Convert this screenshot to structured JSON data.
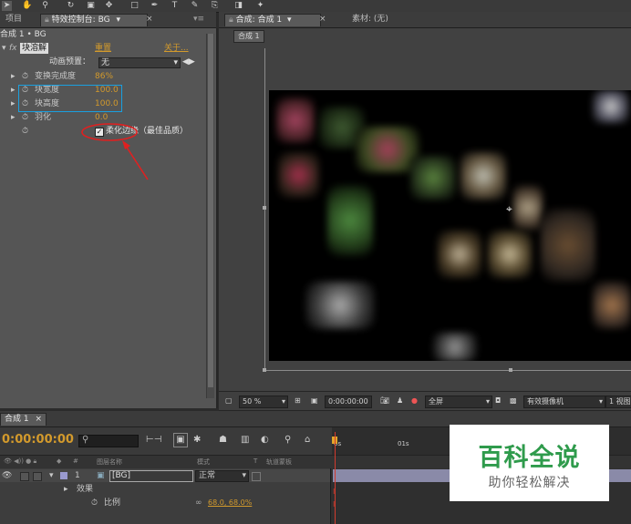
{
  "toolbar": {
    "icons": [
      "selection-tool-icon",
      "hand-tool-icon",
      "zoom-tool-icon",
      "rotate-tool-icon",
      "camera-tool-icon",
      "pan-behind-icon",
      "mask-tool-icon",
      "pen-tool-icon",
      "text-tool-icon",
      "brush-tool-icon",
      "clone-tool-icon",
      "eraser-tool-icon",
      "puppet-tool-icon"
    ]
  },
  "left_panel": {
    "tab_project": "项目",
    "tab_effects": "特效控制台: BG",
    "menu_glyph": "▾≡",
    "breadcrumb": "合成 1 • BG",
    "effect_name": "块溶解",
    "reset": "重置",
    "about": "关于...",
    "preset_label": "动画预置：",
    "preset_value": "无",
    "props": [
      {
        "label": "变换完成度",
        "value": "86%"
      },
      {
        "label": "块宽度",
        "value": "100.0"
      },
      {
        "label": "块高度",
        "value": "100.0"
      },
      {
        "label": "羽化",
        "value": "0.0"
      }
    ],
    "checkbox_label": "柔化边缘（最佳品质）",
    "checkbox_checked": true,
    "fx_badge": "fx"
  },
  "viewer": {
    "tab_comp": "合成: 合成 1",
    "tab_footage": "素材: (无)",
    "comp_chip": "合成 1",
    "bottom": {
      "zoom": "50 %",
      "timecode": "0:00:00:00",
      "resolution": "全屏",
      "camera": "有效摄像机",
      "views": "1 视图"
    }
  },
  "timeline": {
    "tab": "合成 1",
    "timecode": "0:00:00:00",
    "search_placeholder": "",
    "header": {
      "source_name": "图层名称",
      "mode": "模式",
      "t": "T",
      "trkmat": "轨道蒙板"
    },
    "ruler": [
      "0s",
      "01s"
    ],
    "layer": {
      "index": "1",
      "name": "[BG]",
      "mode": "正常"
    },
    "effects_label": "效果",
    "scale_label": "比例",
    "scale_value": "68.0, 68.0%"
  },
  "watermark": {
    "title": "百科全说",
    "subtitle": "助你轻松解决"
  },
  "colors": {
    "accent_orange": "#d39a2c",
    "highlight_blue": "#1aa0e0",
    "annotation_red": "#e02020",
    "playhead": "#d23b2e"
  }
}
